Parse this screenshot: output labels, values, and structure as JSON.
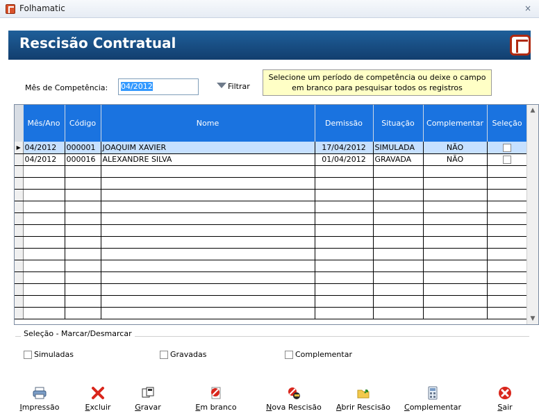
{
  "window": {
    "title": "Folhamatic",
    "close": "×"
  },
  "header": {
    "title": "Rescisão Contratual"
  },
  "filter": {
    "mes_label": "Mês de Competência:",
    "mes_value": "04/2012",
    "filtrar_label": "Filtrar",
    "hint": "Selecione um período de competência ou deixe o campo em branco para pesquisar todos os registros"
  },
  "grid": {
    "columns": [
      "Mês/Ano",
      "Código",
      "Nome",
      "Demissão",
      "Situação",
      "Complementar",
      "Seleção"
    ],
    "rows": [
      {
        "mes_ano": "04/2012",
        "codigo": "000001",
        "nome": "JOAQUIM XAVIER",
        "demissao": "17/04/2012",
        "situacao": "SIMULADA",
        "complementar": "NÃO",
        "selected": true
      },
      {
        "mes_ano": "04/2012",
        "codigo": "000016",
        "nome": "ALEXANDRE SILVA",
        "demissao": "01/04/2012",
        "situacao": "GRAVADA",
        "complementar": "NÃO",
        "selected": false
      }
    ],
    "empty_rows": 13
  },
  "selection": {
    "group_label": "Seleção - Marcar/Desmarcar",
    "simuladas": "Simuladas",
    "gravadas": "Gravadas",
    "complementar": "Complementar"
  },
  "toolbar": {
    "impressao": "Impressão",
    "excluir": "Excluir",
    "gravar": "Gravar",
    "em_branco": "Em branco",
    "nova_rescisao": "Nova Rescisão",
    "abrir_rescisao": "Abrir Rescisão",
    "complementar": "Complementar",
    "sair": "Sair"
  },
  "colors": {
    "header_bg": "#1f5f9a",
    "grid_header_bg": "#1a73e0",
    "selected_row": "#c6e0ff",
    "hint_bg": "#ffffc6"
  }
}
